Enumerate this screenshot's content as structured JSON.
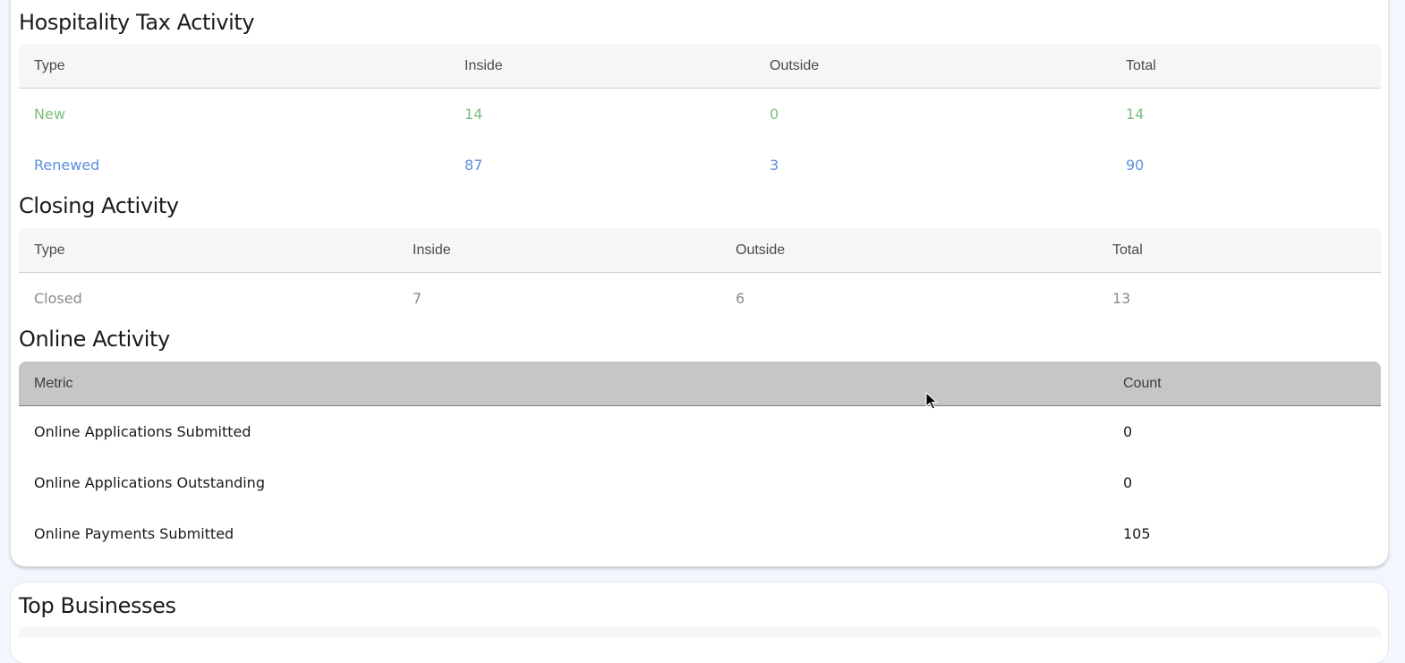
{
  "hospitality": {
    "title": "Hospitality Tax Activity",
    "headers": [
      "Type",
      "Inside",
      "Outside",
      "Total"
    ],
    "rows": [
      {
        "type": "New",
        "inside": "14",
        "outside": "0",
        "total": "14"
      },
      {
        "type": "Renewed",
        "inside": "87",
        "outside": "3",
        "total": "90"
      }
    ]
  },
  "closing": {
    "title": "Closing Activity",
    "headers": [
      "Type",
      "Inside",
      "Outside",
      "Total"
    ],
    "rows": [
      {
        "type": "Closed",
        "inside": "7",
        "outside": "6",
        "total": "13"
      }
    ]
  },
  "online": {
    "title": "Online Activity",
    "headers": [
      "Metric",
      "Count"
    ],
    "rows": [
      {
        "metric": "Online Applications Submitted",
        "count": "0"
      },
      {
        "metric": "Online Applications Outstanding",
        "count": "0"
      },
      {
        "metric": "Online Payments Submitted",
        "count": "105"
      }
    ]
  },
  "top_businesses": {
    "title": "Top Businesses"
  },
  "colors": {
    "new_row": "#7dbe7d",
    "renewed_row": "#5b8fdb",
    "closed_row": "#8a8a8a",
    "online_header": "#c6c6c6"
  }
}
